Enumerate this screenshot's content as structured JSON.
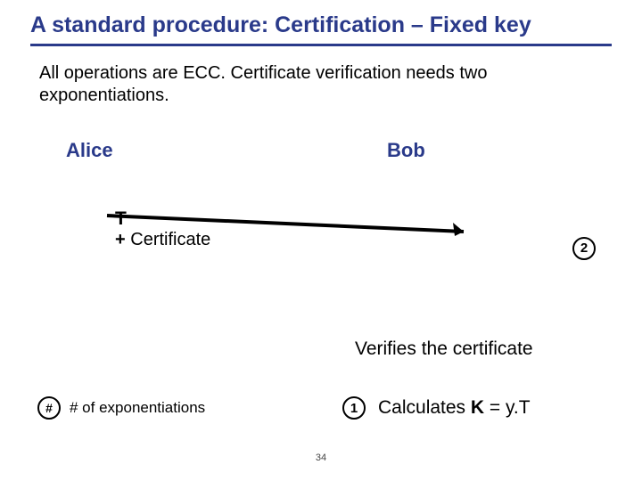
{
  "title": "A standard procedure: Certification – Fixed key",
  "intro": "All operations are ECC. Certificate verification needs two exponentiations.",
  "parties": {
    "alice": "Alice",
    "bob": "Bob"
  },
  "send": {
    "T": "T",
    "plus": "+",
    "cert": "Certificate"
  },
  "badge2": "2",
  "verify_text": "Verifies the certificate",
  "calc": {
    "badge": "1",
    "prefix": "Calculates ",
    "K": "K",
    "suffix": " = y.T"
  },
  "legend": {
    "symbol": "#",
    "text": "# of exponentiations"
  },
  "page": "34"
}
